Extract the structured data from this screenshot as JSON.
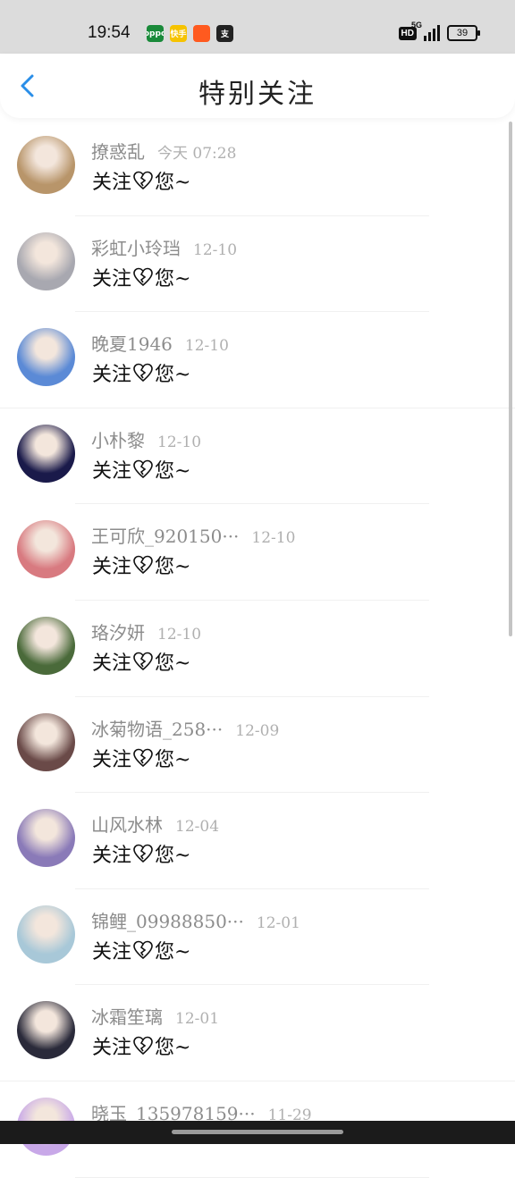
{
  "status_bar": {
    "time": "19:54",
    "apps": [
      {
        "icon": "oppo-app-icon",
        "label": "oppo",
        "color": "#1a8a3a"
      },
      {
        "icon": "kuaishou-icon",
        "label": "快手",
        "color": "#f6c300"
      },
      {
        "icon": "taobao-icon",
        "label": "",
        "color": "#ff5a1f"
      },
      {
        "icon": "alipay-icon",
        "label": "支",
        "color": "#222222"
      }
    ],
    "hd": "HD",
    "network": "5G",
    "battery": "39"
  },
  "header": {
    "title": "特别关注"
  },
  "follows": [
    {
      "name": "撩惑乱",
      "time": "今天 07:28",
      "message": "关注",
      "message_suffix": "您~",
      "avatar_color": "#b8956a"
    },
    {
      "name": "彩虹小玲珰",
      "time": "12-10",
      "message": "关注",
      "message_suffix": "您~",
      "avatar_color": "#a8a8b0"
    },
    {
      "name": "晚夏1946",
      "time": "12-10",
      "message": "关注",
      "message_suffix": "您~",
      "avatar_color": "#5b8ad6"
    },
    {
      "name": "小朴黎",
      "time": "12-10",
      "message": "关注",
      "message_suffix": "您~",
      "avatar_color": "#1a1a4a"
    },
    {
      "name": "王可欣_920150···",
      "time": "12-10",
      "message": "关注",
      "message_suffix": "您~",
      "avatar_color": "#d87a80"
    },
    {
      "name": "珞汐妍",
      "time": "12-10",
      "message": "关注",
      "message_suffix": "您~",
      "avatar_color": "#4a6a3a"
    },
    {
      "name": "冰菊物语_258···",
      "time": "12-09",
      "message": "关注",
      "message_suffix": "您~",
      "avatar_color": "#6a4a48"
    },
    {
      "name": "山风水林",
      "time": "12-04",
      "message": "关注",
      "message_suffix": "您~",
      "avatar_color": "#8a7ab8"
    },
    {
      "name": "锦鲤_09988850···",
      "time": "12-01",
      "message": "关注",
      "message_suffix": "您~",
      "avatar_color": "#a8c8d8"
    },
    {
      "name": "冰霜笙璃",
      "time": "12-01",
      "message": "关注",
      "message_suffix": "您~",
      "avatar_color": "#2a2a3a"
    },
    {
      "name": "晓玉_135978159···",
      "time": "11-29",
      "message": "",
      "message_suffix": "",
      "avatar_color": "#c8a8e8"
    }
  ]
}
